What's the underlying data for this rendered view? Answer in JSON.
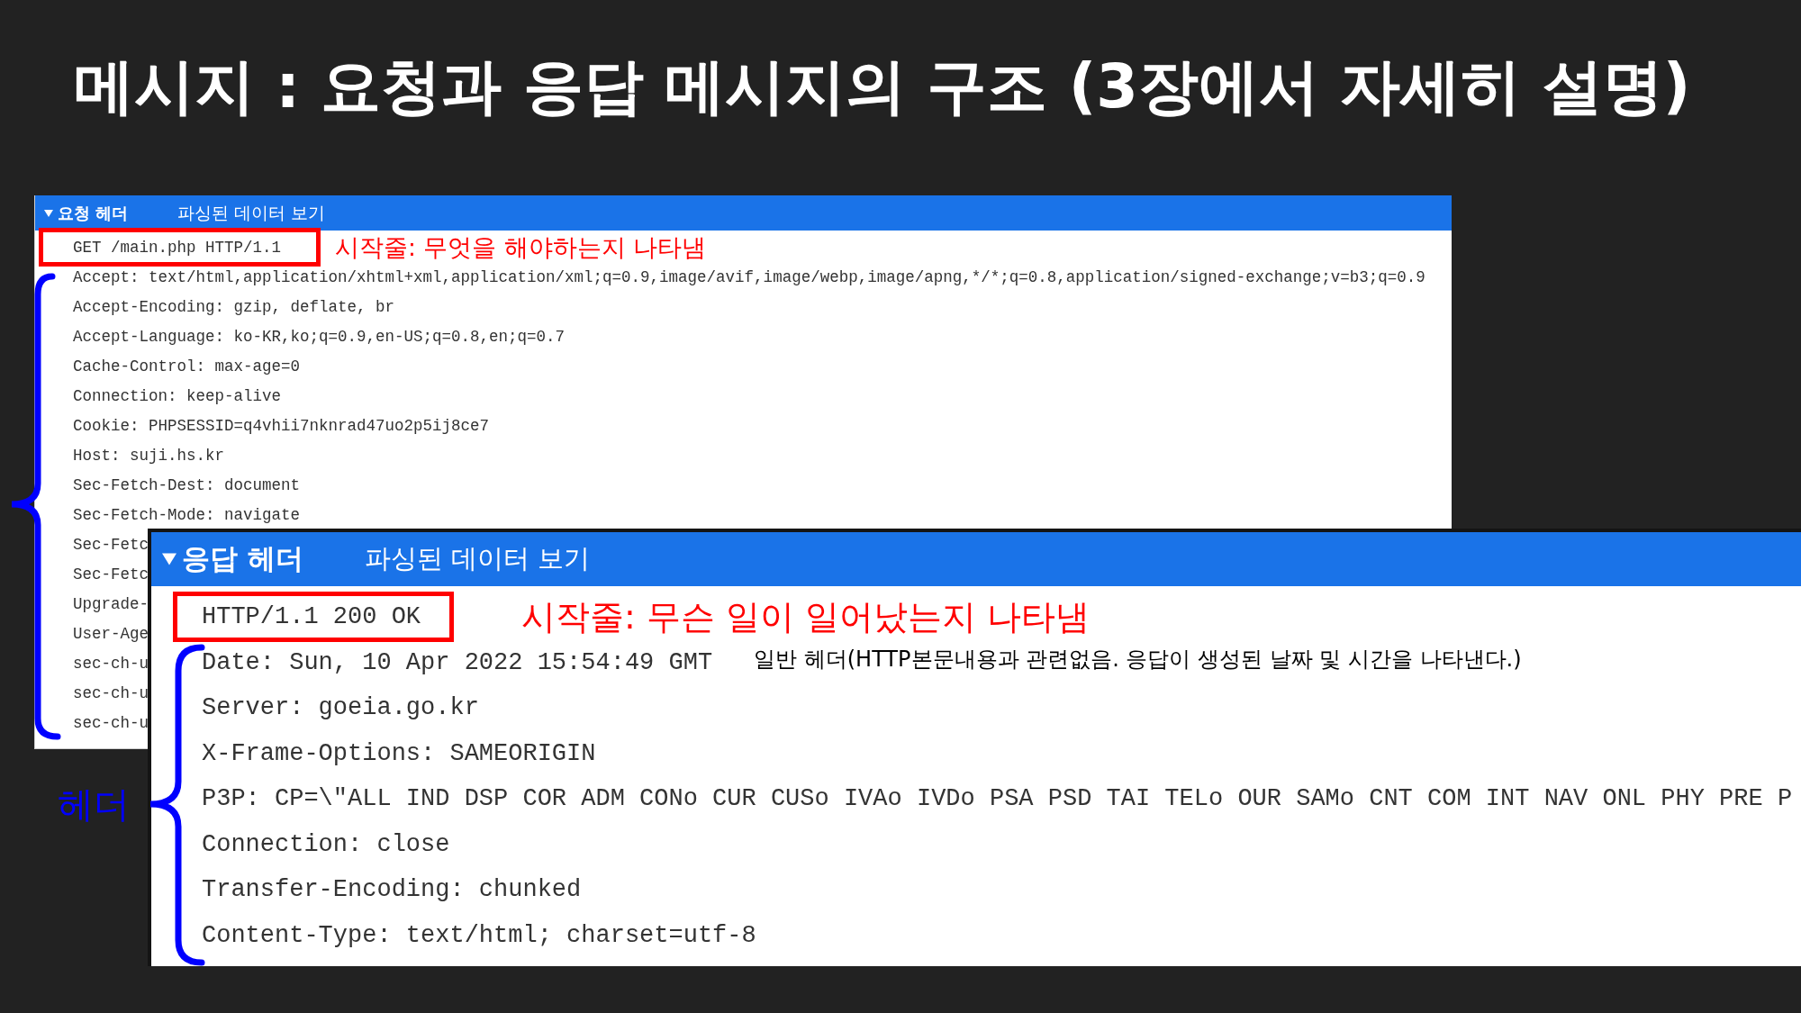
{
  "title": "메시지 : 요청과 응답 메시지의 구조 (3장에서 자세히 설명)",
  "request_panel": {
    "header": {
      "label": "요청 헤더",
      "expanded": true,
      "link": "파싱된 데이터 보기"
    },
    "start_line": "GET /main.php HTTP/1.1",
    "start_line_note": "시작줄: 무엇을 해야하는지 나타냄",
    "lines": [
      {
        "text": "Accept: text/html,application/xhtml+xml,application/xml;q=0.9,image/avif,image/webp,image/apng,*/*;q=0.8,application/signed-exchange;v=b3;q=0.9"
      },
      {
        "text": "Accept-Encoding: gzip, deflate, br"
      },
      {
        "text": "Accept-Language: ko-KR,ko;q=0.9,en-US;q=0.8,en;q=0.7"
      },
      {
        "text": "Cache-Control: max-age=0"
      },
      {
        "text": "Connection: keep-alive"
      },
      {
        "text": "Cookie: PHPSESSID=q4vhii7nknrad47uo2p5ij8ce7"
      },
      {
        "text": "Host: suji.hs.kr"
      },
      {
        "text": "Sec-Fetch-Dest: document"
      },
      {
        "text": "Sec-Fetch-Mode: navigate"
      },
      {
        "text": "Sec-Fetc"
      },
      {
        "text": "Sec-Fetc"
      },
      {
        "text": "Upgrade-"
      },
      {
        "text": "User-Age"
      },
      {
        "text": "sec-ch-u"
      },
      {
        "text": "sec-ch-u"
      },
      {
        "text": "sec-ch-u"
      }
    ]
  },
  "response_panel": {
    "header": {
      "label": "응답 헤더",
      "expanded": true,
      "link": "파싱된 데이터 보기"
    },
    "start_line": "HTTP/1.1 200 OK",
    "start_line_note": "시작줄: 무슨 일이 일어났는지 나타냄",
    "lines": [
      {
        "text": "Date: Sun, 10 Apr 2022 15:54:49 GMT",
        "note": "일반 헤더(HTTP본문내용과 관련없음. 응답이 생성된 날짜 및 시간을 나타낸다.)"
      },
      {
        "text": "Server: goeia.go.kr"
      },
      {
        "text": "X-Frame-Options: SAMEORIGIN"
      },
      {
        "text": "P3P: CP=\\\"ALL IND DSP COR ADM CONo CUR CUSo IVAo IVDo PSA PSD TAI TELo OUR SAMo CNT COM INT NAV ONL PHY PRE P"
      },
      {
        "text": "Connection: close"
      },
      {
        "text": "Transfer-Encoding: chunked"
      },
      {
        "text": "Content-Type: text/html; charset=utf-8"
      }
    ]
  },
  "header_label": "헤더"
}
